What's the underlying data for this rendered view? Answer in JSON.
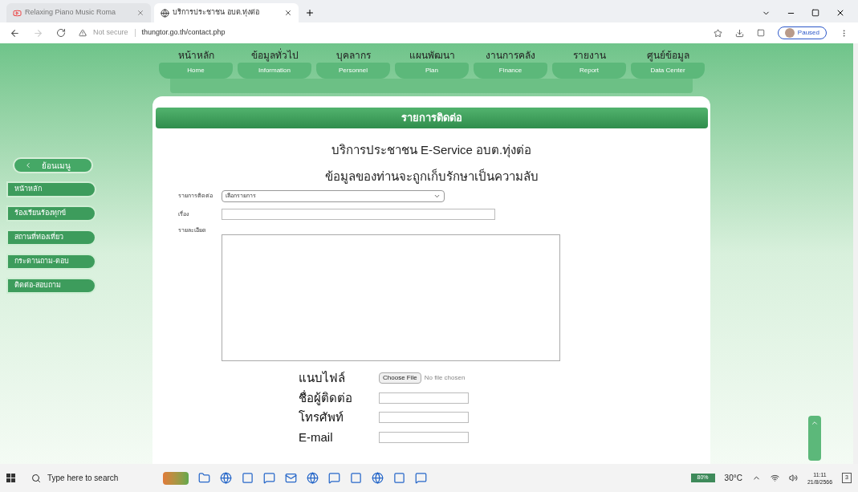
{
  "browser": {
    "tabs": [
      {
        "title": "Relaxing Piano Music Roma",
        "selected": false
      },
      {
        "title": "บริการประชาชน อบต.ทุ่งต่อ",
        "selected": true
      }
    ],
    "security": "Not secure",
    "url": "thungtor.go.th/contact.php",
    "profile": "Paused"
  },
  "nav": [
    {
      "thai": "หน้าหลัก",
      "english": "Home"
    },
    {
      "thai": "ข้อมูลทั่วไป",
      "english": "Information"
    },
    {
      "thai": "บุคลากร",
      "english": "Personnel"
    },
    {
      "thai": "แผนพัฒนา",
      "english": "Plan"
    },
    {
      "thai": "งานการคลัง",
      "english": "Finance"
    },
    {
      "thai": "รายงาน",
      "english": "Report"
    },
    {
      "thai": "ศูนย์ข้อมูล",
      "english": "Data Center"
    }
  ],
  "sidebar": {
    "back": "ย้อนเมนู",
    "items": [
      "หน้าหลัก",
      "ร้องเรียนร้องทุกข์",
      "สถานที่ท่องเที่ยว",
      "กระดานถาม-ตอบ",
      "ติดต่อ-สอบถาม"
    ]
  },
  "panel_title": "รายการติดต่อ",
  "headings": [
    "บริการประชาชน E-Service อบต.ทุ่งต่อ",
    "ข้อมูลของท่านจะถูกเก็บรักษาเป็นความลับ"
  ],
  "form": {
    "type_label": "รายการติดต่อ",
    "type_value": "เลือกรายการ",
    "subject_label": "เรื่อง",
    "detail_label": "รายละเอียด",
    "file_label": "แนบไฟล์",
    "file_button": "Choose File",
    "file_status": "No file chosen",
    "contact_label": "ชื่อผู้ติดต่อ",
    "phone_label": "โทรศัพท์",
    "email_label": "E-mail"
  },
  "taskbar": {
    "search_placeholder": "Type here to search",
    "battery": "80%",
    "weather": "30°C",
    "time": "11:11",
    "date": "21/8/2566",
    "notifications": "3"
  }
}
